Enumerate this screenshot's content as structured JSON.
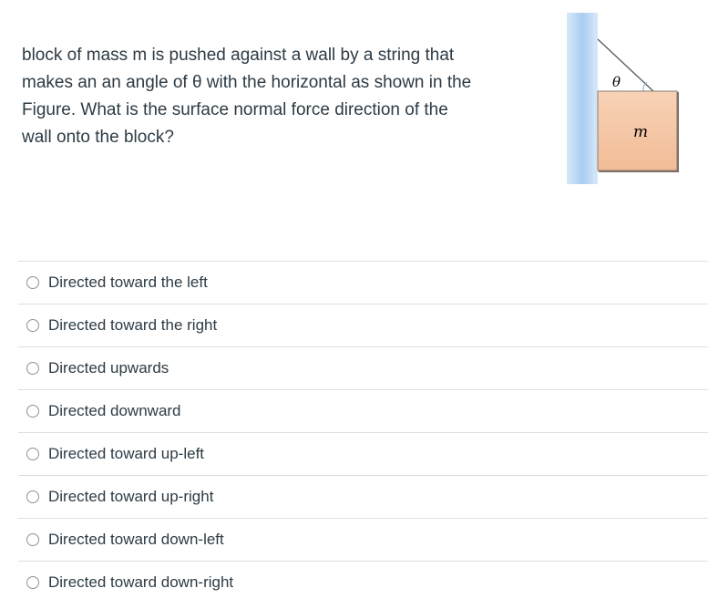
{
  "question": {
    "text": "block of mass m is pushed against a wall by a string that makes an an angle of θ with the horizontal as shown in the Figure. What is the surface normal force direction of the wall onto the block?"
  },
  "figure": {
    "angle_label": "θ",
    "mass_label": "m",
    "wall_color": "#a9cdef",
    "block_color": "#f5c6a5"
  },
  "answers": [
    {
      "label": "Directed toward the left"
    },
    {
      "label": "Directed toward the right"
    },
    {
      "label": "Directed upwards"
    },
    {
      "label": "Directed downward"
    },
    {
      "label": "Directed toward up-left"
    },
    {
      "label": "Directed toward up-right"
    },
    {
      "label": "Directed toward down-left"
    },
    {
      "label": "Directed toward down-right"
    }
  ]
}
